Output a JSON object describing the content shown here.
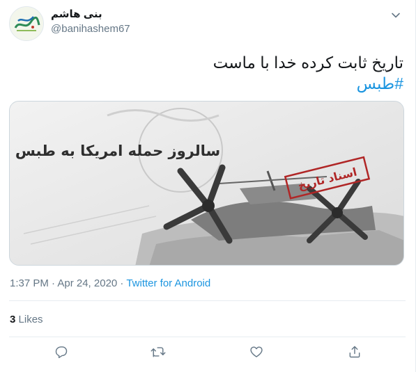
{
  "user": {
    "display_name": "بنی هاشم",
    "handle": "@banihashem67",
    "avatar_icon": "calligraphy-logo-avatar"
  },
  "tweet": {
    "text": "تاریخ ثابت کرده خدا با ماست",
    "hashtag": "#طبس",
    "timestamp": "1:37 PM · Apr 24, 2020 · ",
    "source": "Twitter for Android"
  },
  "media": {
    "headline": "سالروز حمله امریکا به طبس",
    "stamp": "اسناد تاریخ"
  },
  "stats": {
    "likes_count": "3",
    "likes_label": "Likes"
  },
  "actions": {
    "reply_icon": "reply-icon",
    "retweet_icon": "retweet-icon",
    "like_icon": "heart-icon",
    "share_icon": "share-icon"
  },
  "colors": {
    "accent": "#1b95e0",
    "secondary_text": "#657786",
    "divider": "#e6ecf0"
  }
}
